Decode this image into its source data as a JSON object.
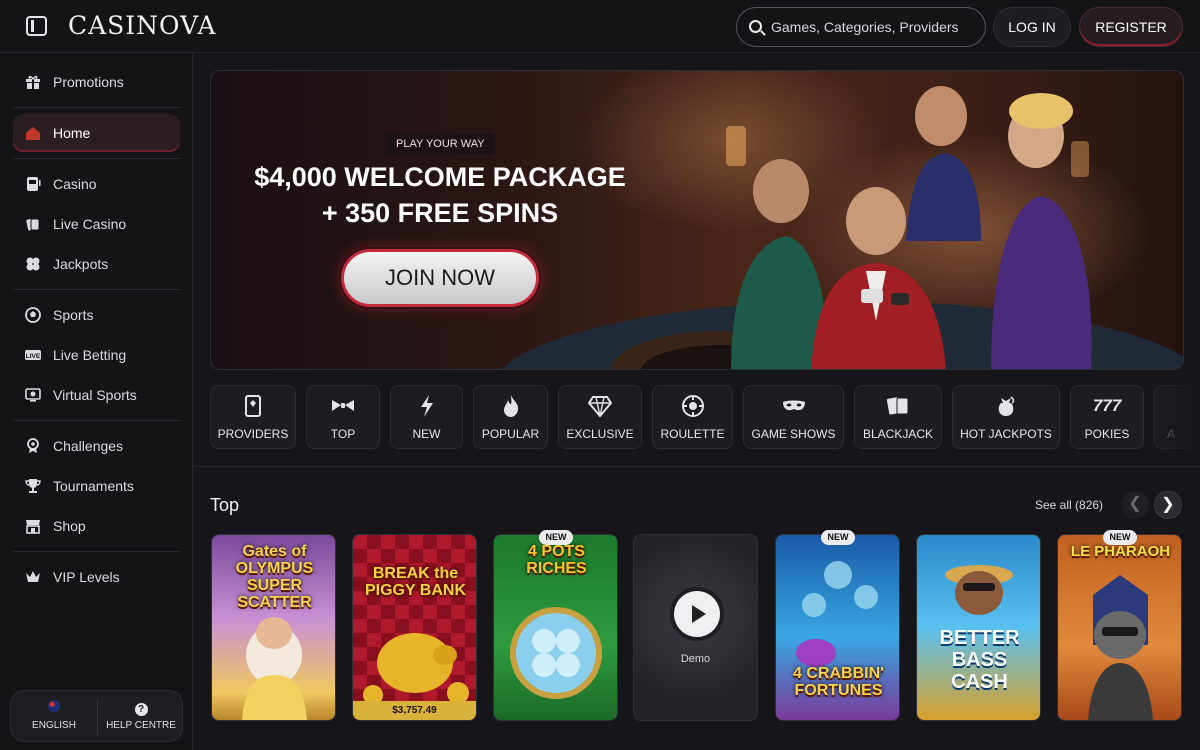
{
  "header": {
    "logo": "CASINOVA",
    "search_placeholder": "Games, Categories, Providers",
    "login_label": "LOG IN",
    "register_label": "REGISTER"
  },
  "sidebar": {
    "items": [
      {
        "label": "Promotions",
        "icon": "gift-icon"
      },
      {
        "label": "Home",
        "icon": "home-icon",
        "active": true
      },
      {
        "label": "Casino",
        "icon": "slot-machine-icon"
      },
      {
        "label": "Live Casino",
        "icon": "live-cards-icon"
      },
      {
        "label": "Jackpots",
        "icon": "clover-icon"
      },
      {
        "label": "Sports",
        "icon": "soccer-ball-icon"
      },
      {
        "label": "Live Betting",
        "icon": "live-badge-icon"
      },
      {
        "label": "Virtual Sports",
        "icon": "virtual-screen-icon"
      },
      {
        "label": "Challenges",
        "icon": "medal-icon"
      },
      {
        "label": "Tournaments",
        "icon": "trophy-icon"
      },
      {
        "label": "Shop",
        "icon": "shop-icon"
      },
      {
        "label": "VIP Levels",
        "icon": "crown-icon"
      }
    ],
    "language_label": "ENGLISH",
    "help_label": "HELP CENTRE"
  },
  "hero": {
    "tag": "PLAY YOUR WAY",
    "title_line1": "$4,000 WELCOME PACKAGE",
    "title_line2": "+ 350 FREE SPINS",
    "cta_label": "JOIN NOW"
  },
  "categories": [
    {
      "label": "PROVIDERS",
      "icon": "book-icon"
    },
    {
      "label": "TOP",
      "icon": "bowtie-icon"
    },
    {
      "label": "NEW",
      "icon": "lightning-icon"
    },
    {
      "label": "POPULAR",
      "icon": "flame-icon"
    },
    {
      "label": "EXCLUSIVE",
      "icon": "diamond-icon"
    },
    {
      "label": "ROULETTE",
      "icon": "roulette-icon"
    },
    {
      "label": "GAME SHOWS",
      "icon": "mask-icon"
    },
    {
      "label": "BLACKJACK",
      "icon": "cards-icon"
    },
    {
      "label": "HOT JACKPOTS",
      "icon": "hot-bag-icon"
    },
    {
      "label": "POKIES",
      "icon": "sevens-icon"
    },
    {
      "label": "A",
      "icon": "partial-icon"
    }
  ],
  "section": {
    "title": "Top",
    "see_all": "See all (826)"
  },
  "games": [
    {
      "title": "Gates of OLYMPUS SUPER SCATTER",
      "badge": "",
      "colors": [
        "#6a3a8a",
        "#c88fd8"
      ]
    },
    {
      "title": "BREAK the PIGGY BANK",
      "badge": "",
      "jackpot": "$3,757.49",
      "colors": [
        "#8a1020",
        "#c41a2c"
      ]
    },
    {
      "title": "4 POTS RICHES",
      "badge": "NEW",
      "colors": [
        "#1d7a2a",
        "#2c9a3a"
      ]
    },
    {
      "title": "",
      "badge": "",
      "demo": "Demo",
      "colors": [
        "#2c2c33",
        "#1f1f24"
      ]
    },
    {
      "title": "4 CRABBIN' FORTUNES",
      "badge": "NEW",
      "colors": [
        "#1a6ab0",
        "#3ab0e0"
      ]
    },
    {
      "title": "BETTER BASS CASH",
      "badge": "",
      "colors": [
        "#2a8ac8",
        "#58c0f0"
      ]
    },
    {
      "title": "LE PHARAOH",
      "badge": "NEW",
      "colors": [
        "#a8501c",
        "#e08a3c"
      ]
    }
  ]
}
